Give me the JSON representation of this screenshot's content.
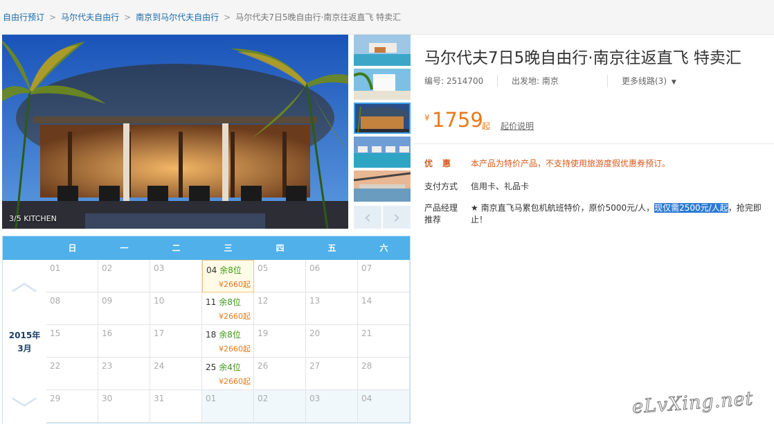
{
  "breadcrumb": {
    "items": [
      "自由行预订",
      "马尔代夫自由行",
      "南京到马尔代夫自由行"
    ],
    "separator": ">",
    "current": "马尔代夫7日5晚自由行·南京往返直飞 特卖汇"
  },
  "gallery": {
    "caption": "3/5 KITCHEN",
    "prev_icon": "‹",
    "next_icon": "›",
    "active_thumbnail": 3
  },
  "product": {
    "title": "马尔代夫7日5晚自由行·南京往返直飞 特卖汇",
    "code": "编号: 2514700",
    "departure": "出发地: 南京",
    "more_routes": "更多线路(3)",
    "more_routes_icon": "▼"
  },
  "price": {
    "currency": "¥",
    "value": "1759",
    "suffix": "起",
    "note": "起价说明"
  },
  "info": {
    "discount_label": "优惠",
    "discount_value": "本产品为特价产品，不支持使用旅游度假优惠券预订。",
    "payment_label": "支付方式",
    "payment_value": "信用卡、礼品卡",
    "manager_label": "产品经理推荐",
    "manager_value_before": "★ 南京直飞马累包机航班特价，原价5000元/人，",
    "manager_value_highlight": "现仅需2500元/人起",
    "manager_value_after": "，抢完即止！"
  },
  "calendar": {
    "year_label": "2015年",
    "month_label": "3月",
    "weekdays": [
      "日",
      "一",
      "二",
      "三",
      "四",
      "五",
      "六"
    ],
    "up_icon": "︿",
    "down_icon": "﹀",
    "weeks": [
      [
        {
          "day": "01"
        },
        {
          "day": "02"
        },
        {
          "day": "03"
        },
        {
          "day": "04",
          "seats": "余8位",
          "price": "¥2660起",
          "selected": true
        },
        {
          "day": "05"
        },
        {
          "day": "06"
        },
        {
          "day": "07"
        }
      ],
      [
        {
          "day": "08"
        },
        {
          "day": "09"
        },
        {
          "day": "10"
        },
        {
          "day": "11",
          "seats": "余8位",
          "price": "¥2660起"
        },
        {
          "day": "12"
        },
        {
          "day": "13"
        },
        {
          "day": "14"
        }
      ],
      [
        {
          "day": "15"
        },
        {
          "day": "16"
        },
        {
          "day": "17"
        },
        {
          "day": "18",
          "seats": "余8位",
          "price": "¥2660起"
        },
        {
          "day": "19"
        },
        {
          "day": "20"
        },
        {
          "day": "21"
        }
      ],
      [
        {
          "day": "22"
        },
        {
          "day": "23"
        },
        {
          "day": "24"
        },
        {
          "day": "25",
          "seats": "余4位",
          "price": "¥2660起"
        },
        {
          "day": "26"
        },
        {
          "day": "27"
        },
        {
          "day": "28"
        }
      ],
      [
        {
          "day": "29"
        },
        {
          "day": "30"
        },
        {
          "day": "31"
        },
        {
          "day": "01",
          "next_month": true
        },
        {
          "day": "02",
          "next_month": true
        },
        {
          "day": "03",
          "next_month": true
        },
        {
          "day": "04",
          "next_month": true
        }
      ]
    ]
  },
  "watermark": "eLvXing.net",
  "colors": {
    "accent_blue": "#4fb0ea",
    "price_orange": "#e8791b",
    "link_blue": "#1a6aa8",
    "seat_green": "#3a9a16",
    "highlight": "#2b7bd6"
  }
}
